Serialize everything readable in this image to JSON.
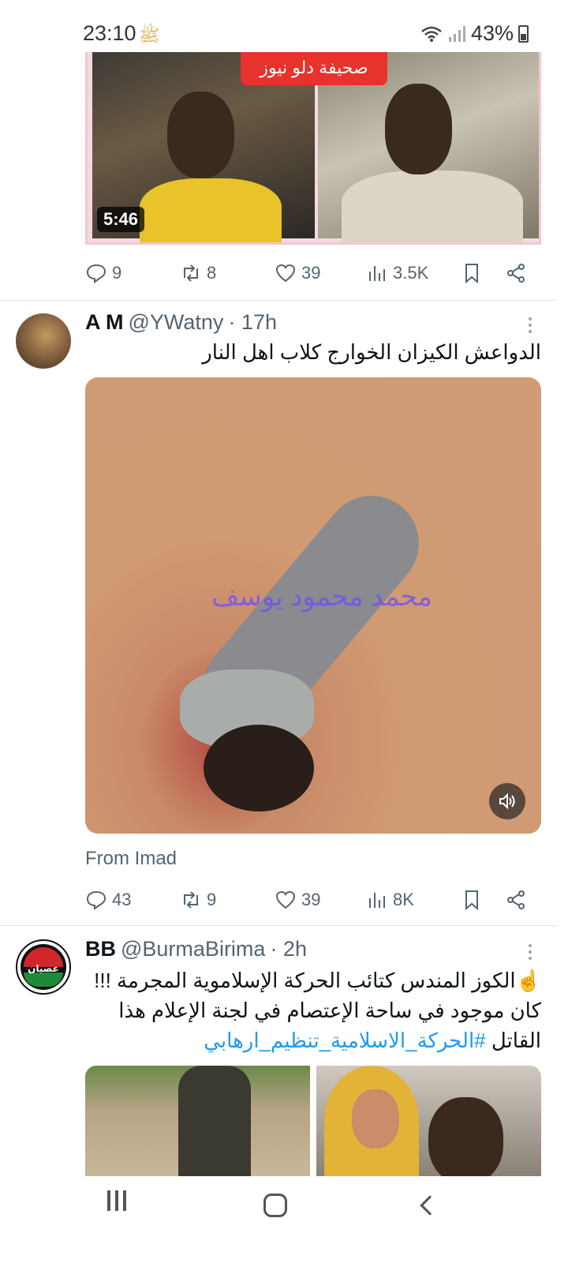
{
  "status_bar": {
    "time": "23:10",
    "extra_glyph": "ﷺ",
    "battery": "43%"
  },
  "tweet1": {
    "video_banner": "صحيفة دلو نيوز",
    "duration": "5:46",
    "actions": {
      "replies": "9",
      "retweets": "8",
      "likes": "39",
      "views": "3.5K"
    }
  },
  "tweet2": {
    "display_name": "A M",
    "handle": "@YWatny",
    "time": "· 17h",
    "text": "الدواعش الكيزان الخوارج كلاب اهل النار",
    "video_watermark": "محمد محمود يوسف",
    "from": "From Imad",
    "actions": {
      "replies": "43",
      "retweets": "9",
      "likes": "39",
      "views": "8K"
    }
  },
  "tweet3": {
    "display_name": "BB",
    "handle": "@BurmaBirima",
    "time": "· 2h",
    "avatar_text": "عصيان",
    "text_line1": "☝️الكوز المندس كتائب الحركة الإسلاموية المجرمة !!!",
    "text_line2": "كان موجود في ساحة الإعتصام  في لجنة الإعلام هذا",
    "text_line3_plain": "القاتل ",
    "hashtag": "#الحركة_الاسلامية_تنظيم_ارهابي"
  },
  "icons": {
    "reply": "reply-icon",
    "retweet": "retweet-icon",
    "like": "heart-icon",
    "views": "views-icon",
    "bookmark": "bookmark-icon",
    "share": "share-icon"
  },
  "colors": {
    "link": "#1d9bf0",
    "muted": "#536471",
    "text": "#0f1419"
  }
}
